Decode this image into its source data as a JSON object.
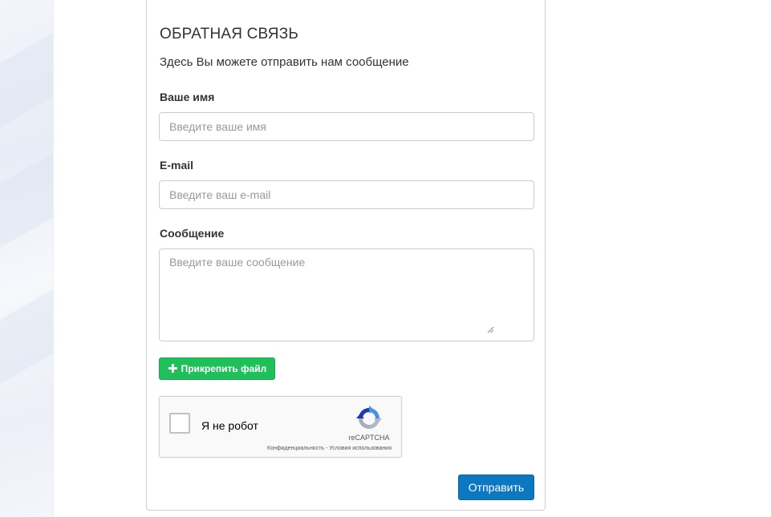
{
  "form": {
    "title": "ОБРАТНАЯ СВЯЗЬ",
    "subtitle": "Здесь Вы можете отправить нам сообщение",
    "name_label": "Ваше имя",
    "name_placeholder": "Введите ваше имя",
    "name_value": "",
    "email_label": "E-mail",
    "email_placeholder": "Введите ваш e-mail",
    "email_value": "",
    "message_label": "Сообщение",
    "message_placeholder": "Введите ваше сообщение",
    "message_value": "",
    "attach_label": "Прикрепить файл",
    "attach_icon": "plus-icon",
    "submit_label": "Отправить"
  },
  "captcha": {
    "checkbox_label": "Я не робот",
    "checked": false,
    "brand": "reCAPTCHA",
    "privacy_link": "Конфиденциальность",
    "separator": " - ",
    "terms_link": "Условия использования",
    "logo_icon": "recaptcha-logo-icon"
  },
  "colors": {
    "attach_button": "#1fbf5a",
    "submit_button": "#0d78c2",
    "panel_border": "#cfcfcf"
  }
}
